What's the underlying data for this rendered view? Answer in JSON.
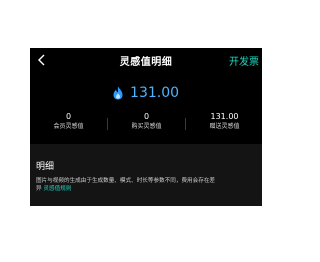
{
  "nav": {
    "title": "灵感值明细",
    "action_label": "开发票"
  },
  "balance": {
    "value": "131.00",
    "icon": "flame-icon",
    "color": "#4fb3ff"
  },
  "stats": [
    {
      "value": "0",
      "label": "会员灵感值"
    },
    {
      "value": "0",
      "label": "购买灵感值"
    },
    {
      "value": "131.00",
      "label": "赠送灵感值"
    }
  ],
  "details": {
    "title": "明细",
    "description_line1": "图片与视频的生成由于生成数量、模式、时长等参数不同，费用会存在差",
    "description_prefix": "异",
    "link_label": "灵感值规则"
  },
  "colors": {
    "accent": "#1ed9c2",
    "background": "#000000",
    "panel": "#141414"
  }
}
